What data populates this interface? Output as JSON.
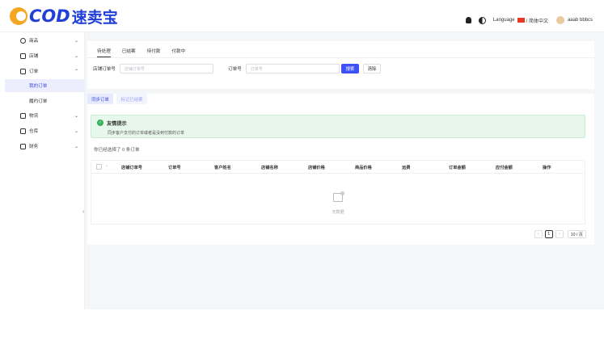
{
  "brand": {
    "logo_text": "COD",
    "logo_cn": "速卖宝"
  },
  "header": {
    "language_label": "Language",
    "language_value": "/ 简体中文",
    "username": "aaab bbbcs"
  },
  "sidebar": {
    "items": [
      {
        "label": "商品",
        "icon": "product-icon"
      },
      {
        "label": "店铺",
        "icon": "store-icon"
      },
      {
        "label": "订单",
        "icon": "order-icon"
      },
      {
        "label": "物流",
        "icon": "logistics-icon"
      },
      {
        "label": "仓库",
        "icon": "warehouse-icon"
      },
      {
        "label": "财务",
        "icon": "finance-icon"
      }
    ],
    "sub_items": [
      {
        "label": "我的订单",
        "active": true
      },
      {
        "label": "履约订单",
        "active": false
      }
    ]
  },
  "filter": {
    "tabs": [
      "待处理",
      "已结案",
      "待付款",
      "付款中"
    ],
    "store_order_label": "店铺订单号",
    "store_order_placeholder": "店铺订单号",
    "order_label": "订单号",
    "order_placeholder": "订单号",
    "search_label": "搜索",
    "clear_label": "清除"
  },
  "actions": {
    "sync_label": "同步订单",
    "mark_label": "标记已结案"
  },
  "alert": {
    "title": "友情提示",
    "message": "同步客户支付的订单或者是没到付款的订单"
  },
  "selection_text": "你已经选择了 0 条订单",
  "table": {
    "columns": [
      "店铺订单号",
      "订单号",
      "客户姓名",
      "店铺名称",
      "店铺价格",
      "商品价格",
      "运费",
      "订单金额",
      "应付金额",
      "操作"
    ],
    "empty_text": "无数据"
  },
  "pagination": {
    "current_page": "1",
    "page_size": "10 / 页"
  },
  "colors": {
    "primary": "#3f51f5",
    "brand": "#1f3fd6",
    "success": "#34b35a"
  }
}
